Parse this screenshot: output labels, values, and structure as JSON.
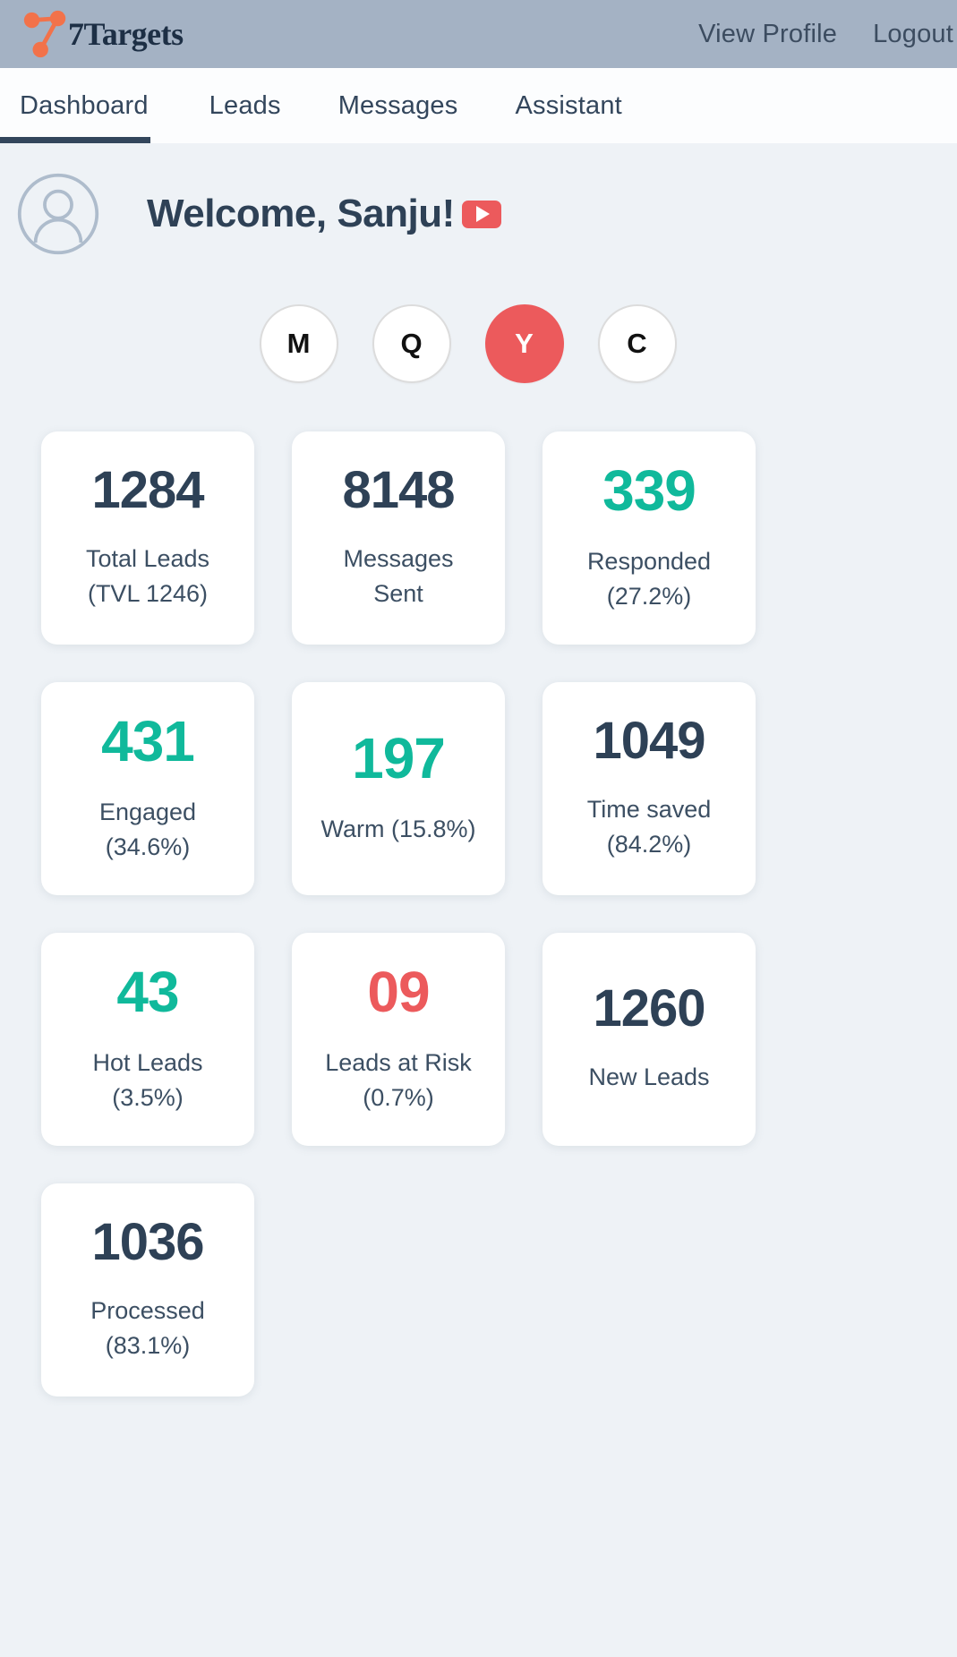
{
  "topbar": {
    "brand_name": "7Targets",
    "logo_icon": "seven-targets-node-logo",
    "links": [
      {
        "label": "View Profile",
        "name": "view-profile-link"
      },
      {
        "label": "Logout",
        "name": "logout-link"
      }
    ]
  },
  "nav": {
    "tabs": [
      {
        "label": "Dashboard",
        "active": true
      },
      {
        "label": "Leads",
        "active": false
      },
      {
        "label": "Messages",
        "active": false
      },
      {
        "label": "Assistant",
        "active": false
      }
    ]
  },
  "welcome": {
    "avatar_icon": "user-avatar-icon",
    "title": "Welcome, Sanju!",
    "video_icon": "youtube-play-icon"
  },
  "period_selector": {
    "options": [
      {
        "label": "M",
        "selected": false
      },
      {
        "label": "Q",
        "selected": false
      },
      {
        "label": "Y",
        "selected": true
      },
      {
        "label": "C",
        "selected": false
      }
    ]
  },
  "colors": {
    "accent_teal": "#10b99b",
    "accent_red": "#ec5a5c",
    "text_dark": "#2e4156",
    "topbar_bg": "#a4b2c4",
    "page_bg": "#eef2f6"
  },
  "metrics": [
    {
      "value": "1284",
      "label": "Total Leads\n(TVL 1246)",
      "label_line1": "Total Leads",
      "label_line2": "(TVL 1246)",
      "tone": "dark"
    },
    {
      "value": "8148",
      "label_line1": "Messages",
      "label_line2": "Sent",
      "tone": "dark"
    },
    {
      "value": "339",
      "label_line1": "Responded",
      "label_line2": "(27.2%)",
      "tone": "teal"
    },
    {
      "value": "431",
      "label_line1": "Engaged",
      "label_line2": "(34.6%)",
      "tone": "teal"
    },
    {
      "value": "197",
      "label_line1": "Warm (15.8%)",
      "label_line2": "",
      "tone": "teal"
    },
    {
      "value": "1049",
      "label_line1": "Time saved",
      "label_line2": "(84.2%)",
      "tone": "dark"
    },
    {
      "value": "43",
      "label_line1": "Hot Leads",
      "label_line2": "(3.5%)",
      "tone": "teal"
    },
    {
      "value": "09",
      "label_line1": "Leads at Risk",
      "label_line2": "(0.7%)",
      "tone": "red"
    },
    {
      "value": "1260",
      "label_line1": "New Leads",
      "label_line2": "",
      "tone": "dark"
    },
    {
      "value": "1036",
      "label_line1": "Processed",
      "label_line2": "(83.1%)",
      "tone": "dark"
    }
  ]
}
